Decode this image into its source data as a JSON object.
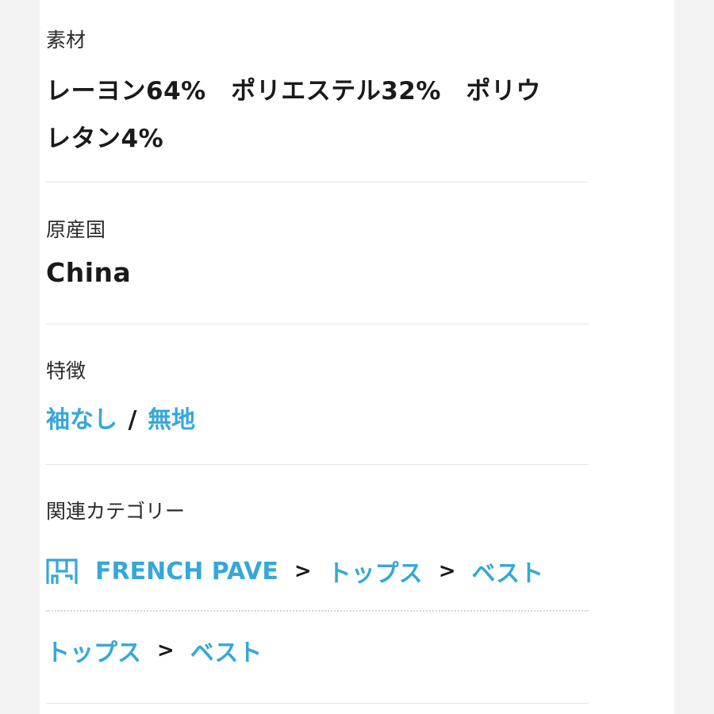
{
  "material": {
    "label": "素材",
    "line1": "レーヨン64%　ポリエステル32%　ポリウ",
    "line2": "レタン4%"
  },
  "origin": {
    "label": "原産国",
    "value": "China"
  },
  "features": {
    "label": "特徴",
    "items": [
      "袖なし",
      "無地"
    ],
    "separator": "/"
  },
  "related": {
    "label": "関連カテゴリー",
    "brand_path": {
      "icon": "shop-icon",
      "brand": "FRENCH PAVE",
      "category": "トップス",
      "subcategory": "ベスト",
      "arrow": ">"
    },
    "category_path": {
      "category": "トップス",
      "subcategory": "ベスト",
      "arrow": ">"
    }
  },
  "colors": {
    "link": "#35a8d8",
    "text": "#1a1a1a"
  }
}
